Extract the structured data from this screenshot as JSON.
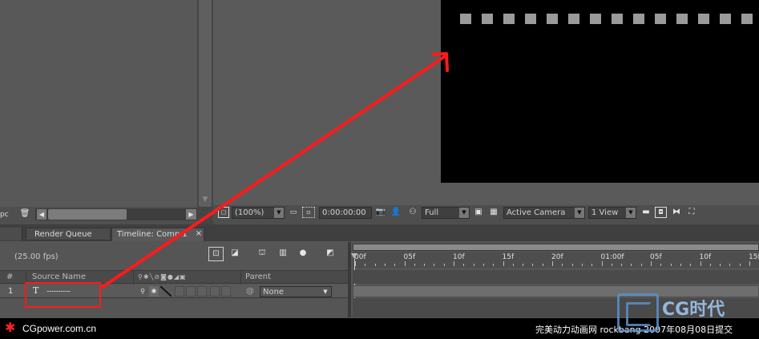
{
  "project_panel": {
    "scroll_left_icon": "arrow-left-icon",
    "scroll_right_icon": "arrow-right-icon",
    "trash_icon": "trash-icon",
    "partial_label": "pc"
  },
  "viewer": {
    "zoom": "(100%)",
    "timecode": "0:00:00:00",
    "resolution": "Full",
    "camera": "Active Camera",
    "views": "1 View"
  },
  "tabs": [
    {
      "label": "Render Queue"
    },
    {
      "label": "Timeline: Comp 1"
    }
  ],
  "timeline": {
    "fps": "(25.00 fps)",
    "columns": {
      "num": "#",
      "source": "Source Name",
      "parent": "Parent"
    },
    "layer": {
      "index": "1",
      "type_icon": "T",
      "name": "...................",
      "parent": "None"
    },
    "ruler": [
      "00f",
      "05f",
      "10f",
      "15f",
      "20f",
      "01:00f",
      "05f",
      "10f",
      "15f"
    ]
  },
  "watermark": {
    "site": "CGpower.com.cn",
    "credit": "完美动力动画网 rockbang 2007年08月08日提交",
    "logo_text": "CG时代"
  },
  "colors": {
    "annotation": "#ff1a1a",
    "composition_bg": "#000000"
  }
}
